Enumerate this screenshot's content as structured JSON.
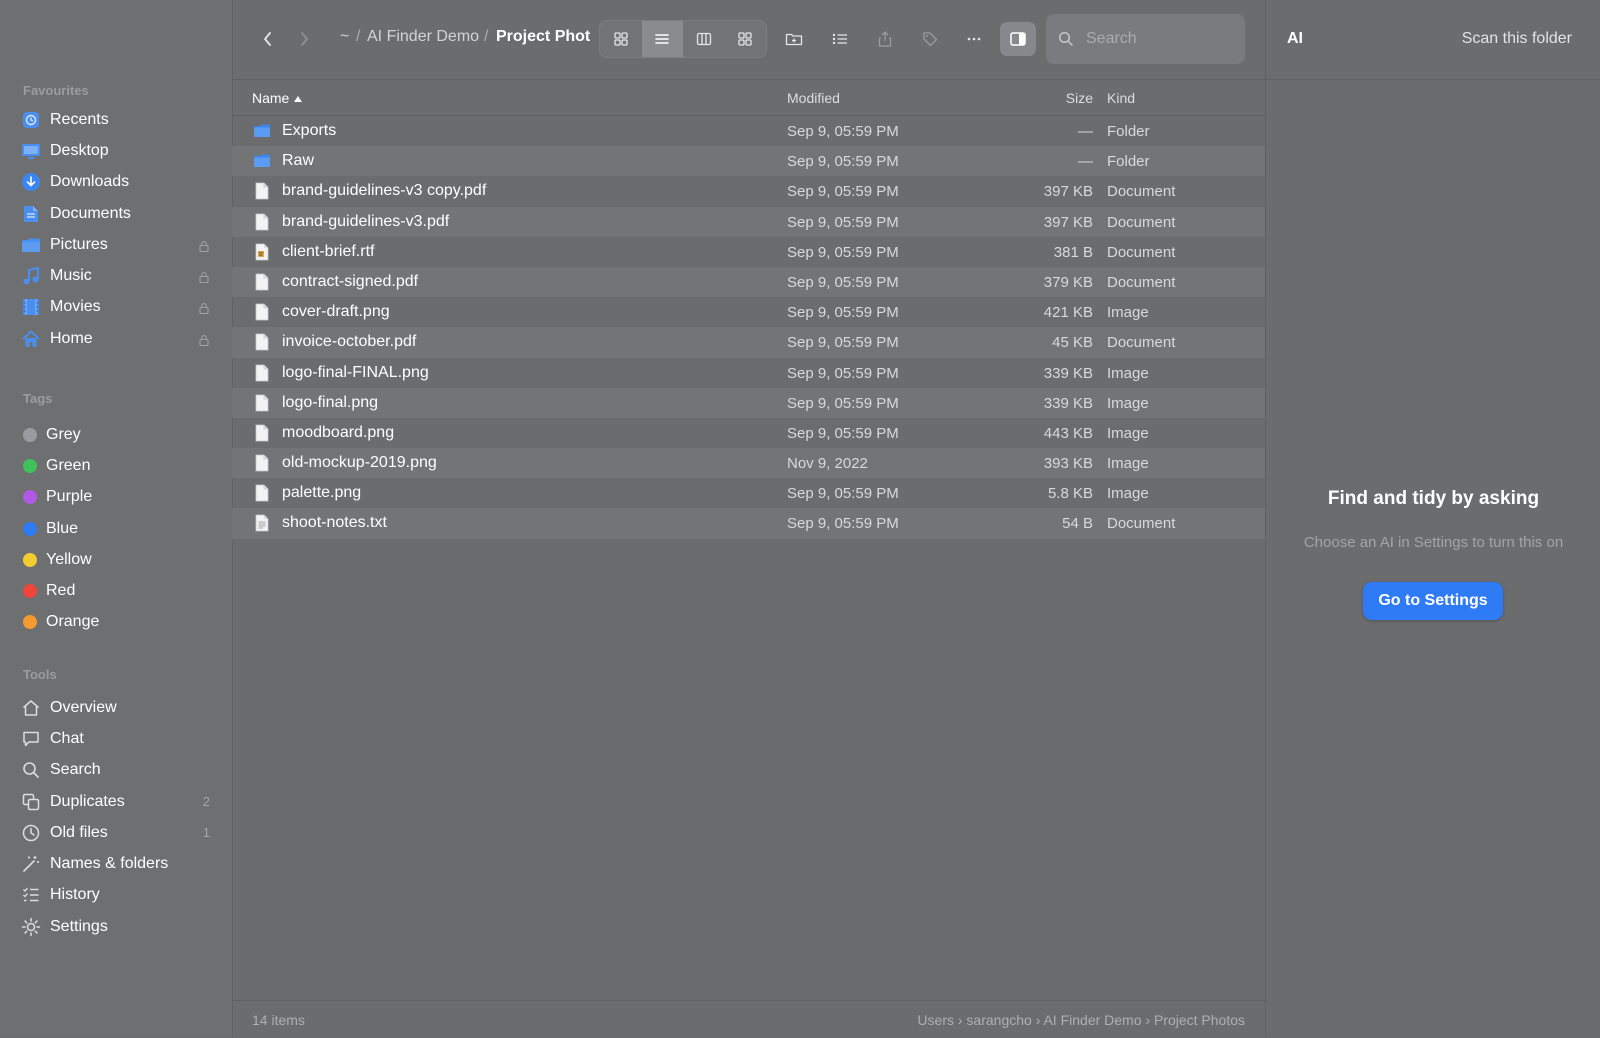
{
  "sidebar": {
    "favourites_heading": "Favourites",
    "favourites": [
      {
        "label": "Recents",
        "icon": "recents-icon",
        "locked": false
      },
      {
        "label": "Desktop",
        "icon": "desktop-icon",
        "locked": false
      },
      {
        "label": "Downloads",
        "icon": "downloads-icon",
        "locked": false
      },
      {
        "label": "Documents",
        "icon": "documents-icon",
        "locked": false
      },
      {
        "label": "Pictures",
        "icon": "pictures-icon",
        "locked": true
      },
      {
        "label": "Music",
        "icon": "music-icon",
        "locked": true
      },
      {
        "label": "Movies",
        "icon": "movies-icon",
        "locked": true
      },
      {
        "label": "Home",
        "icon": "home-icon",
        "locked": true
      }
    ],
    "tags_heading": "Tags",
    "tags": [
      {
        "label": "Grey",
        "color": "#9a9b9e"
      },
      {
        "label": "Green",
        "color": "#3fc25a"
      },
      {
        "label": "Purple",
        "color": "#b159e6"
      },
      {
        "label": "Blue",
        "color": "#2f7bf5"
      },
      {
        "label": "Yellow",
        "color": "#f5cc2f"
      },
      {
        "label": "Red",
        "color": "#f0453a"
      },
      {
        "label": "Orange",
        "color": "#f59a2f"
      }
    ],
    "tools_heading": "Tools",
    "tools": [
      {
        "label": "Overview",
        "icon": "house-outline-icon",
        "badge": ""
      },
      {
        "label": "Chat",
        "icon": "chat-bubble-icon",
        "badge": ""
      },
      {
        "label": "Search",
        "icon": "magnifier-icon",
        "badge": ""
      },
      {
        "label": "Duplicates",
        "icon": "duplicates-icon",
        "badge": "2"
      },
      {
        "label": "Old files",
        "icon": "clock-icon",
        "badge": "1"
      },
      {
        "label": "Names & folders",
        "icon": "magic-wand-icon",
        "badge": ""
      },
      {
        "label": "History",
        "icon": "checklist-icon",
        "badge": ""
      },
      {
        "label": "Settings",
        "icon": "sun-gear-icon",
        "badge": ""
      }
    ]
  },
  "toolbar": {
    "breadcrumb_home": "~",
    "breadcrumb_sep": "/",
    "breadcrumb_parent": "AI Finder Demo",
    "breadcrumb_current": "Project Phot",
    "active_view": "list",
    "search_placeholder": "Search"
  },
  "columns": {
    "name": "Name",
    "modified": "Modified",
    "size": "Size",
    "kind": "Kind"
  },
  "files": [
    {
      "name": "Exports",
      "modified": "Sep 9, 05:59 PM",
      "size": "—",
      "kind": "Folder",
      "type": "folder"
    },
    {
      "name": "Raw",
      "modified": "Sep 9, 05:59 PM",
      "size": "—",
      "kind": "Folder",
      "type": "folder"
    },
    {
      "name": "brand-guidelines-v3 copy.pdf",
      "modified": "Sep 9, 05:59 PM",
      "size": "397 KB",
      "kind": "Document",
      "type": "doc"
    },
    {
      "name": "brand-guidelines-v3.pdf",
      "modified": "Sep 9, 05:59 PM",
      "size": "397 KB",
      "kind": "Document",
      "type": "doc"
    },
    {
      "name": "client-brief.rtf",
      "modified": "Sep 9, 05:59 PM",
      "size": "381 B",
      "kind": "Document",
      "type": "rtf"
    },
    {
      "name": "contract-signed.pdf",
      "modified": "Sep 9, 05:59 PM",
      "size": "379 KB",
      "kind": "Document",
      "type": "doc"
    },
    {
      "name": "cover-draft.png",
      "modified": "Sep 9, 05:59 PM",
      "size": "421 KB",
      "kind": "Image",
      "type": "doc"
    },
    {
      "name": "invoice-october.pdf",
      "modified": "Sep 9, 05:59 PM",
      "size": "45 KB",
      "kind": "Document",
      "type": "doc"
    },
    {
      "name": "logo-final-FINAL.png",
      "modified": "Sep 9, 05:59 PM",
      "size": "339 KB",
      "kind": "Image",
      "type": "doc"
    },
    {
      "name": "logo-final.png",
      "modified": "Sep 9, 05:59 PM",
      "size": "339 KB",
      "kind": "Image",
      "type": "doc"
    },
    {
      "name": "moodboard.png",
      "modified": "Sep 9, 05:59 PM",
      "size": "443 KB",
      "kind": "Image",
      "type": "doc"
    },
    {
      "name": "old-mockup-2019.png",
      "modified": "Nov 9, 2022",
      "size": "393 KB",
      "kind": "Image",
      "type": "doc"
    },
    {
      "name": "palette.png",
      "modified": "Sep 9, 05:59 PM",
      "size": "5.8 KB",
      "kind": "Image",
      "type": "doc"
    },
    {
      "name": "shoot-notes.txt",
      "modified": "Sep 9, 05:59 PM",
      "size": "54 B",
      "kind": "Document",
      "type": "txt"
    }
  ],
  "statusbar": {
    "count": "14 items",
    "path": "Users › sarangcho › AI Finder Demo › Project Photos"
  },
  "ai_panel": {
    "title": "AI",
    "scan_label": "Scan this folder",
    "empty_title": "Find and tidy by asking",
    "empty_subtitle": "Choose an AI in Settings to turn this on",
    "button_label": "Go to Settings"
  }
}
